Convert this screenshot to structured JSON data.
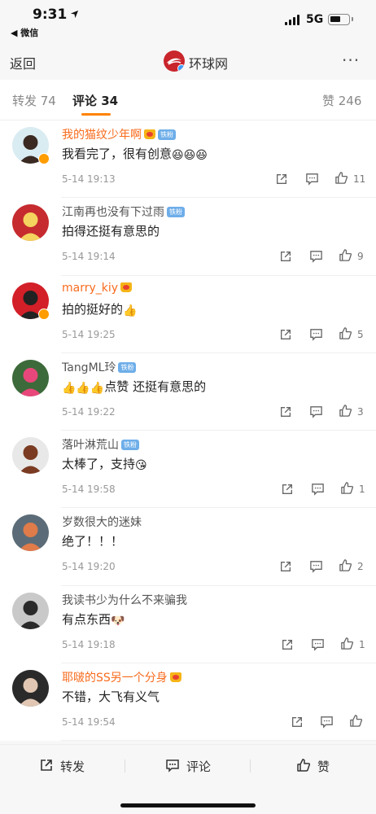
{
  "status": {
    "time": "9:31",
    "network": "5G",
    "back_app": "◀ 微信"
  },
  "nav": {
    "back": "返回",
    "title": "环球网",
    "more": "···"
  },
  "tabs": {
    "repost": "转发 74",
    "comment": "评论 34",
    "like": "赞 246"
  },
  "fan_badge": "铁粉",
  "comments": [
    {
      "name": "我的猫纹少年啊",
      "text": "我看完了，很有创意",
      "emojis": "😆😆😆",
      "time": "5-14 19:13",
      "likes": "11"
    },
    {
      "name": "江南再也没有下过雨",
      "text": "拍得还挺有意思的",
      "emojis": "",
      "time": "5-14 19:14",
      "likes": "9"
    },
    {
      "name": "marry_kiy",
      "text": "拍的挺好的",
      "emojis": "👍",
      "time": "5-14 19:25",
      "likes": "5"
    },
    {
      "name": "TangML玲",
      "text": "点赞 还挺有意思的",
      "emojis": "👍👍👍",
      "time": "5-14 19:22",
      "likes": "3"
    },
    {
      "name": "落叶淋荒山",
      "text": "太棒了，支持",
      "emojis": "😘",
      "time": "5-14 19:58",
      "likes": "1"
    },
    {
      "name": "岁数很大的迷妹",
      "text": "绝了！！！",
      "emojis": "",
      "time": "5-14 19:20",
      "likes": "2"
    },
    {
      "name": "我读书少为什么不来骗我",
      "text": "有点东西",
      "emojis": "🐶",
      "time": "5-14 19:18",
      "likes": "1"
    },
    {
      "name": "耶啵的SS另一个分身",
      "text": "不错，大飞有义气",
      "emojis": "",
      "time": "5-14 19:54",
      "likes": ""
    }
  ],
  "bottom": {
    "repost": "转发",
    "comment": "评论",
    "like": "赞"
  },
  "colors": {
    "accent": "#ff8200",
    "vip_name": "#f86b1d",
    "fan_badge": "#6eaee9"
  }
}
